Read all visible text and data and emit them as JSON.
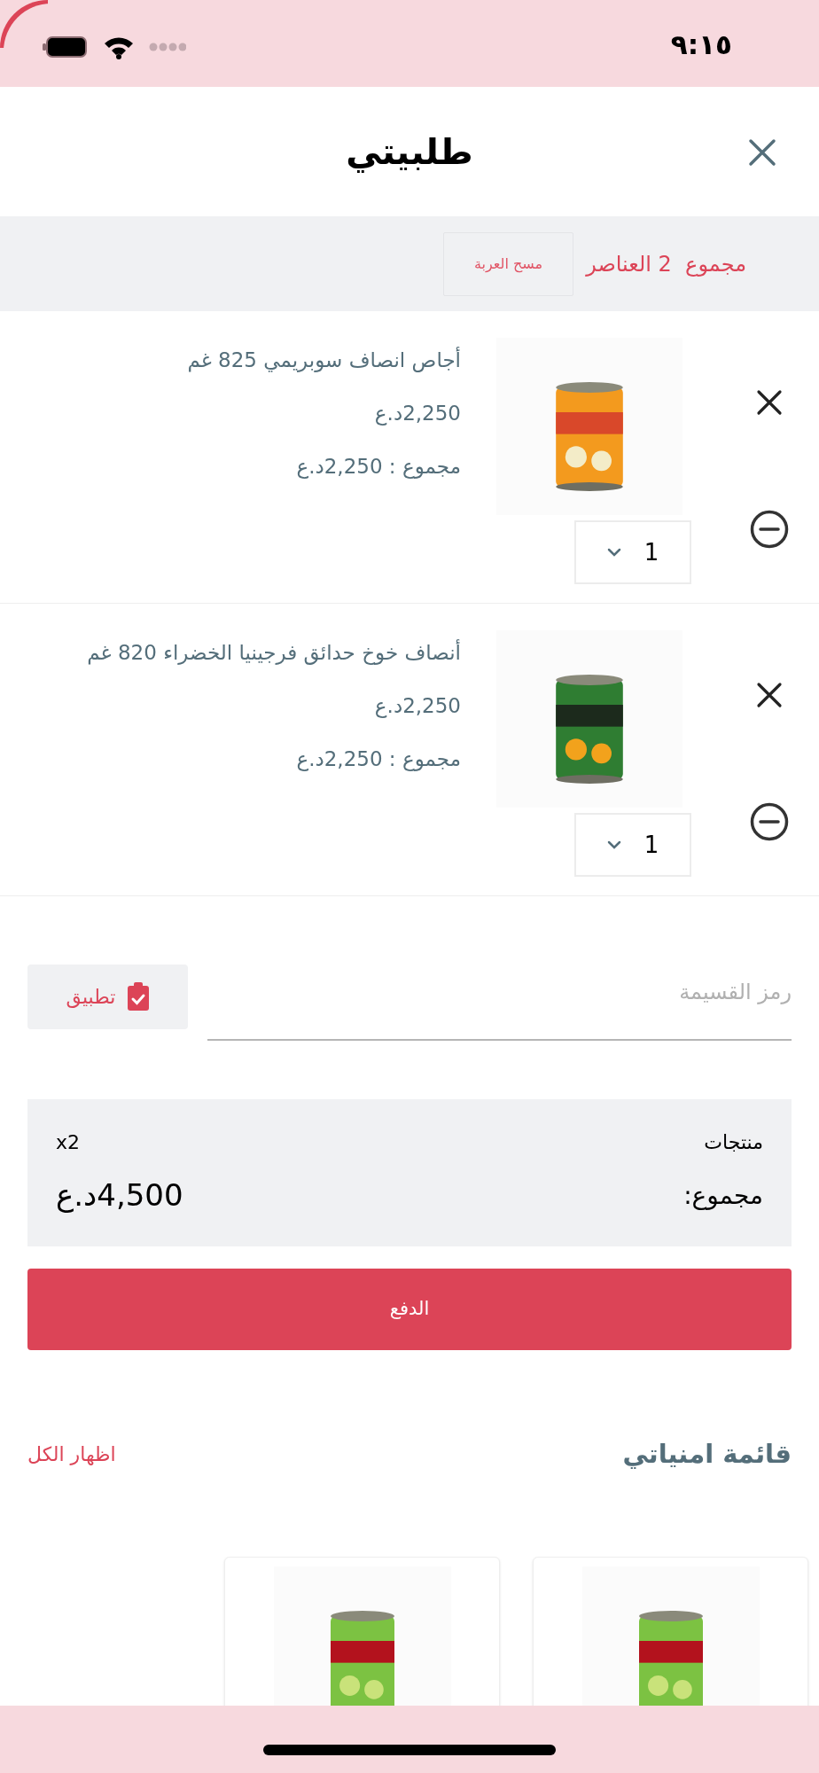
{
  "status_bar": {
    "time": "٩:١٥"
  },
  "header": {
    "title": "طلبيتي"
  },
  "cart_bar": {
    "count_label": "مجموع  2 العناصر",
    "clear_button": "مسح العربة"
  },
  "items": [
    {
      "name": "أجاص انصاف سوبريمي 825 غم",
      "price": "2,250د.ع",
      "total": "مجموع : 2,250د.ع",
      "quantity": "1"
    },
    {
      "name": "أنصاف خوخ حدائق فرجينيا الخضراء 820 غم",
      "price": "2,250د.ع",
      "total": "مجموع : 2,250د.ع",
      "quantity": "1"
    }
  ],
  "coupon": {
    "placeholder": "رمز القسيمة",
    "apply_button": "تطبيق"
  },
  "summary": {
    "products_label": "منتجات",
    "products_count": "x2",
    "total_label": "مجموع:",
    "total_value": "4,500د.ع"
  },
  "checkout_button": "الدفع",
  "wishlist": {
    "title": "قائمة امنياتي",
    "show_all": "اظهار الكل"
  }
}
